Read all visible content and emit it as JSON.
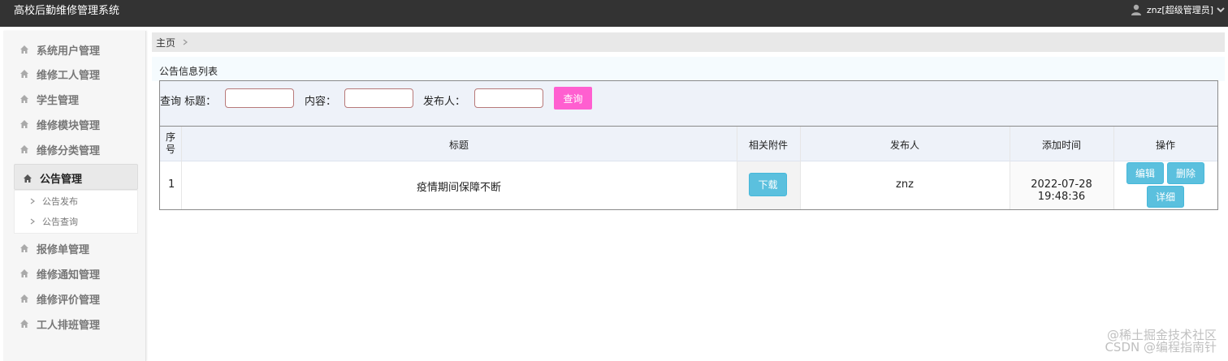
{
  "header": {
    "app_title": "高校后勤维修管理系统",
    "user_label": "znz[超级管理员]"
  },
  "sidebar": {
    "items": [
      {
        "label": "系统用户管理"
      },
      {
        "label": "维修工人管理"
      },
      {
        "label": "学生管理"
      },
      {
        "label": "维修模块管理"
      },
      {
        "label": "维修分类管理"
      },
      {
        "label": "公告管理"
      },
      {
        "label": "报修单管理"
      },
      {
        "label": "维修通知管理"
      },
      {
        "label": "维修评价管理"
      },
      {
        "label": "工人排班管理"
      }
    ],
    "sub_items": [
      {
        "label": "公告发布"
      },
      {
        "label": "公告查询"
      }
    ]
  },
  "breadcrumb": {
    "home": "主页"
  },
  "panel": {
    "title": "公告信息列表",
    "search": {
      "query_label": "查询 标题：",
      "content_label": "内容：",
      "publisher_label": "发布人：",
      "button": "查询"
    }
  },
  "table": {
    "headers": {
      "index_1": "序",
      "index_2": "号",
      "title": "标题",
      "attachment": "相关附件",
      "publisher": "发布人",
      "time": "添加时间",
      "actions": "操作"
    },
    "rows": [
      {
        "index": "1",
        "title": "疫情期间保障不断",
        "download": "下载",
        "publisher": "znz",
        "time": "2022-07-28 19:48:36",
        "edit": "编辑",
        "delete": "删除",
        "detail": "详细"
      }
    ]
  },
  "watermark": {
    "line1": "@稀土掘金技术社区",
    "line2": "CSDN @编程指南针"
  }
}
